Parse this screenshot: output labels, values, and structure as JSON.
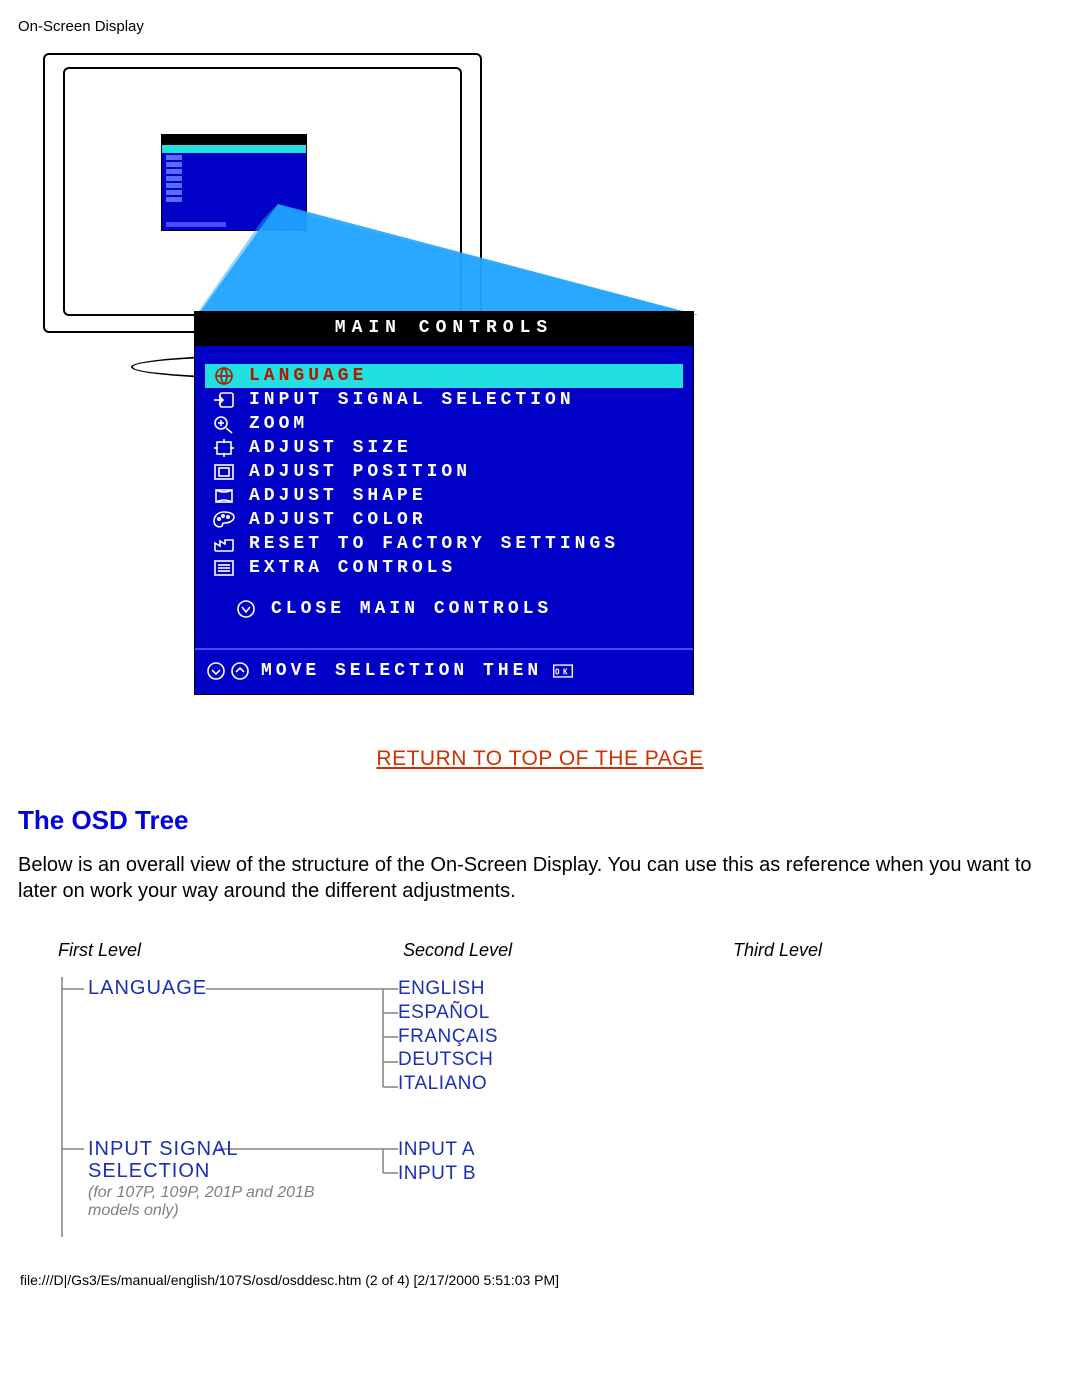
{
  "header": "On-Screen Display",
  "osd": {
    "title": "MAIN CONTROLS",
    "items": [
      "LANGUAGE",
      "INPUT SIGNAL SELECTION",
      "ZOOM",
      "ADJUST SIZE",
      "ADJUST POSITION",
      "ADJUST SHAPE",
      "ADJUST COLOR",
      "RESET TO FACTORY SETTINGS",
      "EXTRA CONTROLS"
    ],
    "close": "CLOSE MAIN CONTROLS",
    "footer_move": "MOVE SELECTION THEN",
    "footer_ok": "OK"
  },
  "return_link": "RETURN TO TOP OF THE PAGE",
  "section_title": "The OSD Tree",
  "section_body": "Below is an overall view of the structure of the On-Screen Display. You can use this as reference when you want to later on work your way around the different adjustments.",
  "tree_headers": {
    "first": "First Level",
    "second": "Second Level",
    "third": "Third Level"
  },
  "tree": [
    {
      "label": "LANGUAGE",
      "note": "",
      "children": [
        "ENGLISH",
        "ESPAÑOL",
        "FRANÇAIS",
        "DEUTSCH",
        "ITALIANO"
      ]
    },
    {
      "label": "INPUT SIGNAL SELECTION",
      "note": "(for 107P, 109P, 201P and 201B models only)",
      "children": [
        "INPUT A",
        "INPUT B"
      ]
    }
  ],
  "footer_path": "file:///D|/Gs3/Es/manual/english/107S/osd/osddesc.htm (2 of 4) [2/17/2000 5:51:03 PM]"
}
